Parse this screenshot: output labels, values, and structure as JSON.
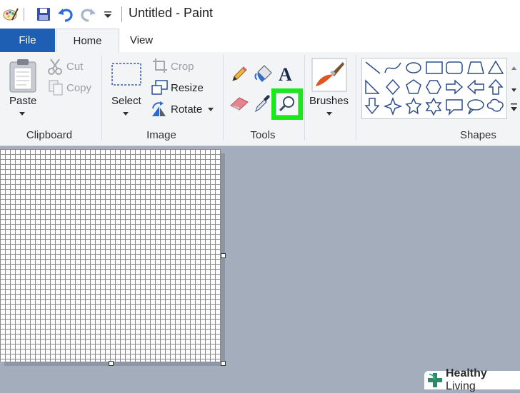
{
  "window": {
    "title": "Untitled - Paint"
  },
  "tabs": {
    "file": "File",
    "home": "Home",
    "view": "View"
  },
  "clipboard": {
    "paste": "Paste",
    "cut": "Cut",
    "copy": "Copy",
    "group_label": "Clipboard"
  },
  "image": {
    "select": "Select",
    "crop": "Crop",
    "resize": "Resize",
    "rotate": "Rotate",
    "group_label": "Image"
  },
  "tools": {
    "group_label": "Tools",
    "selected_tool": "magnifier"
  },
  "brushes": {
    "label": "Brushes"
  },
  "shapes": {
    "group_label": "Shapes",
    "items": [
      "line",
      "curve",
      "oval",
      "rectangle",
      "rounded-rectangle",
      "polygon",
      "triangle",
      "right-triangle",
      "diamond",
      "pentagon",
      "hexagon",
      "right-arrow",
      "left-arrow",
      "up-arrow",
      "down-arrow",
      "four-point-star",
      "five-point-star",
      "six-point-star",
      "rounded-callout",
      "oval-callout",
      "cloud-callout"
    ]
  },
  "watermark": {
    "brand_bold": "Healthy",
    "brand_rest": "Living"
  },
  "colors": {
    "file_tab": "#1f5fb3",
    "highlight": "#19e819",
    "workspace": "#a3adbb",
    "ribbon": "#f3f4f6"
  }
}
